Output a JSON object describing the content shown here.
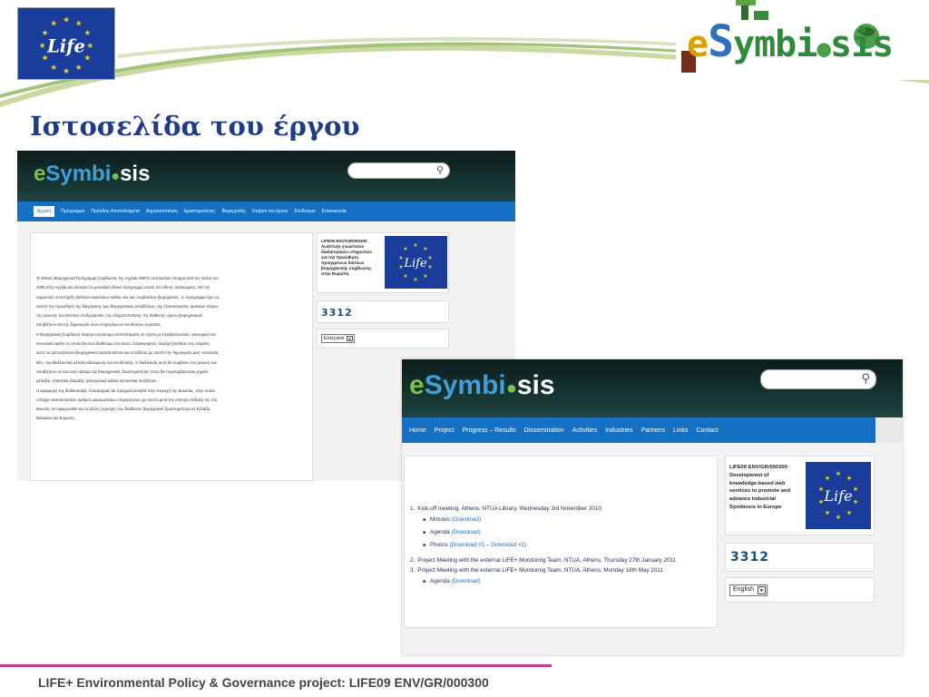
{
  "slide": {
    "title": "Ιστοσελίδα του έργου",
    "footer": "LIFE+ Environmental Policy & Governance project: LIFE09 ENV/GR/000300"
  },
  "logos": {
    "life_text": "Life",
    "brand": {
      "e": "e",
      "s": "S",
      "mid": "ymbi",
      "o": "●",
      "end": "sis"
    }
  },
  "colors": {
    "title": "#1f3c88",
    "footer_line": "#c2408f",
    "nav": "#1570c4",
    "header": "#163432"
  },
  "shot_greek": {
    "logo": {
      "e": "e",
      "word": "Symbi",
      "dot": "●",
      "end": "sis"
    },
    "nav": [
      "Αρχική",
      "Πρόγραμμα",
      "Πρόοδος-Αποτελέσματα",
      "Δημοσιοποίηση",
      "Δραστηριότητες",
      "Βιομηχανίες",
      "Εταίροι του έργου",
      "Σύνδεσμοι",
      "Επικοινωνία"
    ],
    "body_paragraphs": [
      "Το Εθνικό Βιομηχανικό Πρόγραμμα Συμβίωσης της Αγγλίας ΕΒΠΣ υλοποιείται επίσημα από τον Ιούλιο του",
      "2005 στην Αγγλία και αποτελεί το μοναδικό εθνικό πρόγραμμα αυτού του είδους παγκοσμίως. Με την",
      "σημαντική υποστήριξη διεθνών κεφαλαίων καθώς και των συμβούλων βιομηχανίας, το πρόγραμμα έχει ως",
      "σκοπό την προώθηση της διαχείρισης των βιομηχανικών αποβλήτων, της εξοικονόμησης φυσικών πόρων,",
      "της μείωσης του κόστους επεξεργασίας, της ελαχιστοποίησης της διάθεσης υγρών βιομηχανικών",
      "αποβλήτων και της δημιουργία νέων επιχειρήσεων και θέσεων εργασίας.",
      "Η Βιομηχανική Συμβίωση παρέχει μετρήσιμα αποτελέσματα σε σχέση με περιβαλλοντικά, οικονομικά και",
      "κοινωνικά οφέλη τα οποία θα είναι διαθέσιμα στο κοινό. Συγκεκριμένα, παρέχει βοήθεια στις εταιρείες",
      "ώστε να εμπορεύονται βιομηχανικά παραπροϊόντα και απόβλητα με σκοπό την δημιουργία μιας «κανονίας",
      "ΒΣ», περιβαλλοντικά αλληλεπιδρώμενης και αποδοτικής. Η διαδικασία αυτή θα συμβάλει στη μείωση των",
      "αποβλήτων σε ένα ευρύ φάσμα της βιομηχανικής δραστηριότητας όπου θα περιλαμβάνονται χημικά,",
      "μέταλλα, πλαστικά, βιομάζα, ηλεκτρονικά καθώς και αστικά απόβλητα.",
      "Η εφαρμογή της διαδικτυακής πλατφόρμας θα πραγματοποιηθεί στην περιοχή της Βοιωτίας, στην οποία",
      "υπάρχει ικανοποιητικός αριθμός μικρομεσαίων επιχειρήσεων με σκοπό μετά την επιτυχή επίδειξη της στη",
      "Βοιωτία, να εφαρμοσθεί και σε άλλες περιοχές που διαθέτουν βιομηχανική δραστηριότητα σε Ελλάδα,",
      "Βαλκάνια και Ευρώπη."
    ],
    "project_code": "LIFE09 ENV/GR/000300",
    "project_desc": [
      "Ανάπτυξη γνωστικών",
      "διαδικτυακών υπηρεσιών",
      "για την προώθηση",
      "προηγμένων δικτύων",
      "βιομηχανικής συμβίωσης",
      "στην Ευρώπη"
    ],
    "counter": "3312",
    "language": "Ελληνικά"
  },
  "shot_english": {
    "logo": {
      "e": "e",
      "word": "Symbi",
      "dot": "●",
      "end": "sis"
    },
    "nav": [
      "Home",
      "Project",
      "Progress – Results",
      "Dissemination",
      "Activities",
      "Industries",
      "Partners",
      "Links",
      "Contact"
    ],
    "events": [
      {
        "num": "1.",
        "title": "Kick-off meeting, Athens, NTUA Library, Wednesday 3rd November 2010",
        "items": [
          {
            "label": "Minutes",
            "link": "(Download)"
          },
          {
            "label": "Agenda",
            "link": "(Download)"
          },
          {
            "label": "Photos",
            "link": "(Download #1 – Download #2)"
          }
        ]
      },
      {
        "num": "2.",
        "title": "Project Meeting with the external LIFE+ Monitoring Team, NTUA, Athens, Thursday 27th January 2011",
        "items": []
      },
      {
        "num": "3.",
        "title": "Project Meeting with the external LIFE+ Monitoring Team, NTUA, Athens, Monday 16th May 2011",
        "items": [
          {
            "label": "Agenda",
            "link": "(Download)"
          }
        ]
      }
    ],
    "project_code": "LIFE09 ENV/GR/000300",
    "project_desc": [
      "Development of",
      "knowledge-based web",
      "services to promote and",
      "advance industrial",
      "Symbiosis in Europe"
    ],
    "counter": "3312",
    "language": "English"
  },
  "icons": [
    "search-icon",
    "dropdown-arrow-icon",
    "eu-flag-icon",
    "bullet-icon"
  ]
}
